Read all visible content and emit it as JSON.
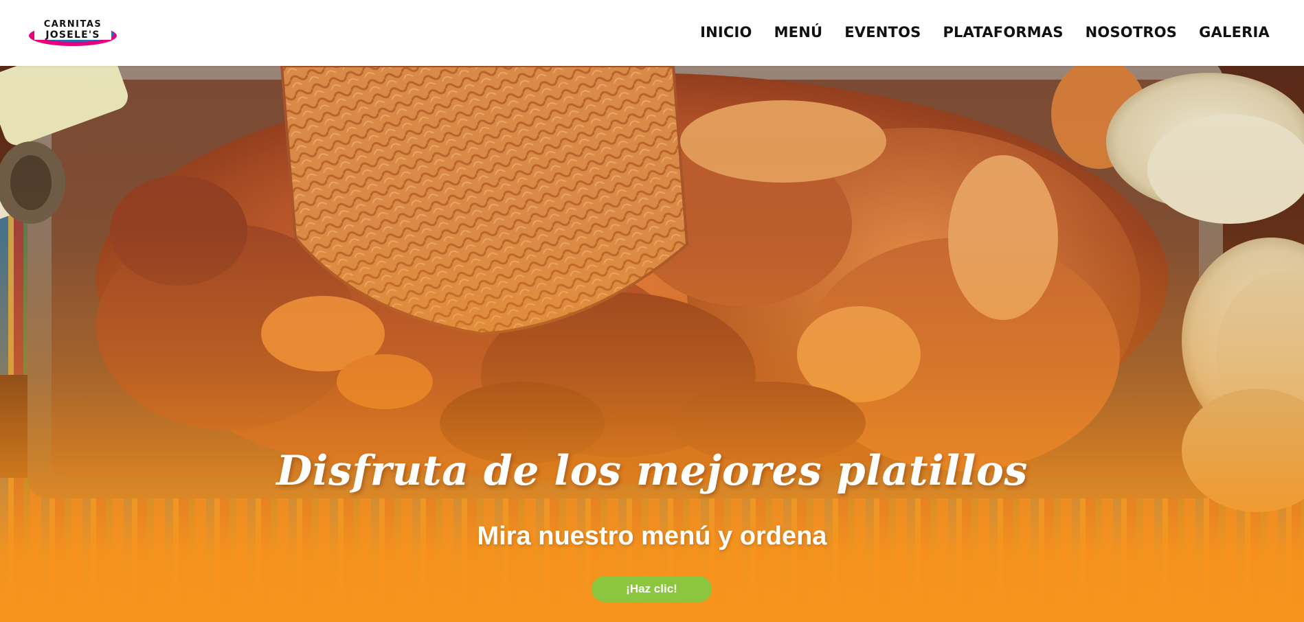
{
  "brand": {
    "logo_text_top": "CARNITAS",
    "logo_text_bottom": "JOSELE'S",
    "colors": {
      "primary_orange": "#f7941d",
      "cta_green": "#8cc63f",
      "nav_text": "#111111",
      "logo_pink": "#e6007e",
      "logo_blue": "#1b75bb"
    }
  },
  "nav": {
    "items": [
      {
        "label": "INICIO"
      },
      {
        "label": "MENÚ"
      },
      {
        "label": "EVENTOS"
      },
      {
        "label": "PLATAFORMAS"
      },
      {
        "label": "NOSOTROS"
      },
      {
        "label": "GALERIA"
      }
    ]
  },
  "hero": {
    "title": "Disfruta de los mejores platillos",
    "subtitle": "Mira nuestro menú y ordena",
    "cta_label": "¡Haz clic!"
  }
}
